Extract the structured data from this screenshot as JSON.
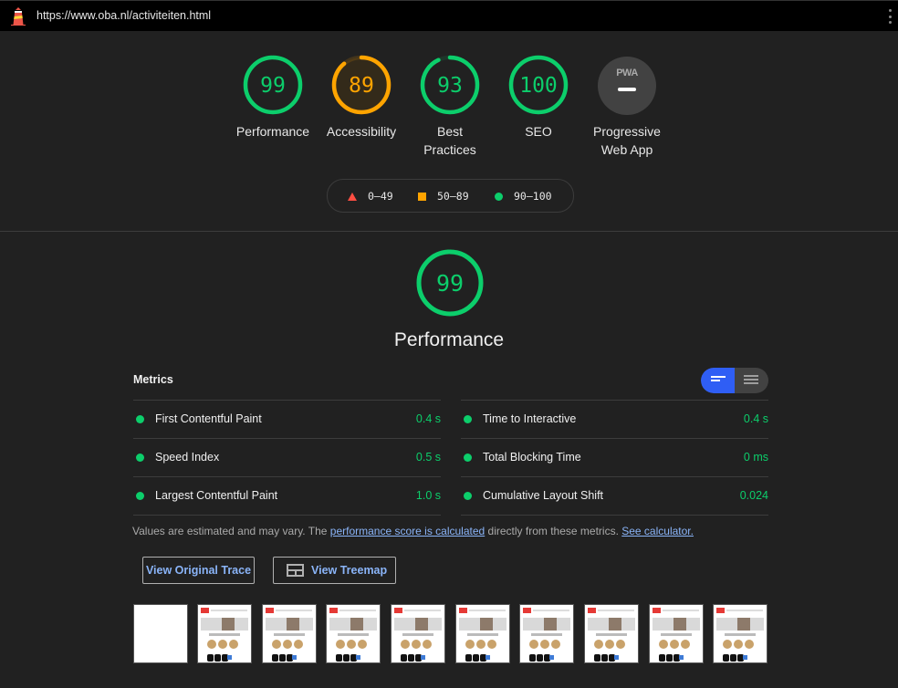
{
  "topbar": {
    "url": "https://www.oba.nl/activiteiten.html",
    "logo_icon": "lighthouse-icon",
    "menu_icon": "kebab-menu-icon"
  },
  "gauges": [
    {
      "score": "99",
      "label": "Performance",
      "value": 0.99,
      "color": "#0cce6b"
    },
    {
      "score": "89",
      "label": "Accessibility",
      "value": 0.89,
      "color": "#ffa400"
    },
    {
      "score": "93",
      "label": "Best Practices",
      "value": 0.93,
      "color": "#0cce6b"
    },
    {
      "score": "100",
      "label": "SEO",
      "value": 1.0,
      "color": "#0cce6b"
    }
  ],
  "pwa": {
    "badge": "PWA",
    "label_line1": "Progressive",
    "label_line2": "Web App"
  },
  "legend": {
    "fail": "0–49",
    "average": "50–89",
    "pass": "90–100"
  },
  "colors": {
    "pass": "#0cce6b",
    "average": "#ffa400",
    "fail": "#ff4e42",
    "link": "#8ab4f8",
    "toggle_active": "#2f5ef5"
  },
  "performance": {
    "score": "99",
    "value": 0.99,
    "title": "Performance",
    "metrics_heading": "Metrics",
    "metrics_left": [
      {
        "name": "First Contentful Paint",
        "value": "0.4 s"
      },
      {
        "name": "Speed Index",
        "value": "0.5 s"
      },
      {
        "name": "Largest Contentful Paint",
        "value": "1.0 s"
      }
    ],
    "metrics_right": [
      {
        "name": "Time to Interactive",
        "value": "0.4 s"
      },
      {
        "name": "Total Blocking Time",
        "value": "0 ms"
      },
      {
        "name": "Cumulative Layout Shift",
        "value": "0.024"
      }
    ],
    "note_prefix": "Values are estimated and may vary. The ",
    "note_link1": "performance score is calculated",
    "note_middle": " directly from these metrics. ",
    "note_link2": "See calculator.",
    "btn_trace": "View Original Trace",
    "btn_treemap": "View Treemap"
  }
}
